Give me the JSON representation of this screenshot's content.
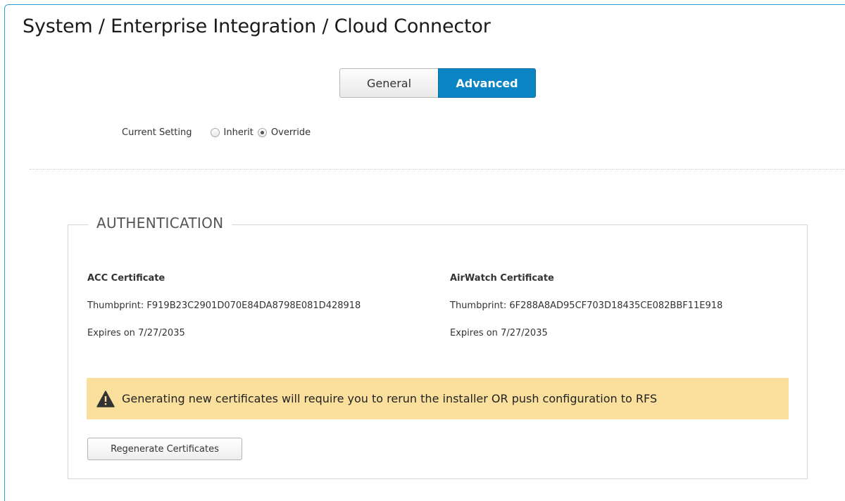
{
  "breadcrumb": {
    "title": "System / Enterprise Integration / Cloud Connector"
  },
  "tabs": [
    {
      "label": "General",
      "active": false
    },
    {
      "label": "Advanced",
      "active": true
    }
  ],
  "current_setting": {
    "label": "Current Setting",
    "options": [
      {
        "label": "Inherit",
        "selected": false
      },
      {
        "label": "Override",
        "selected": true
      }
    ]
  },
  "authentication": {
    "legend": "AUTHENTICATION",
    "acc_certificate": {
      "title": "ACC Certificate",
      "thumbprint_label": "Thumbprint:",
      "thumbprint": "F919B23C2901D070E84DA8798E081D428918",
      "expires_label": "Expires on",
      "expires": "7/27/2035"
    },
    "airwatch_certificate": {
      "title": "AirWatch Certificate",
      "thumbprint_label": "Thumbprint:",
      "thumbprint": "6F288A8AD95CF703D18435CE082BBF11E918",
      "expires_label": "Expires on",
      "expires": "7/27/2035"
    },
    "warning": {
      "icon": "warning-triangle-icon",
      "text": "Generating new certificates will require you to rerun the installer OR push configuration to RFS"
    },
    "regenerate_label": "Regenerate Certificates"
  },
  "colors": {
    "accent": "#0a84c2",
    "frame_border": "#2aa0d6",
    "warning_bg": "#fae09c"
  }
}
